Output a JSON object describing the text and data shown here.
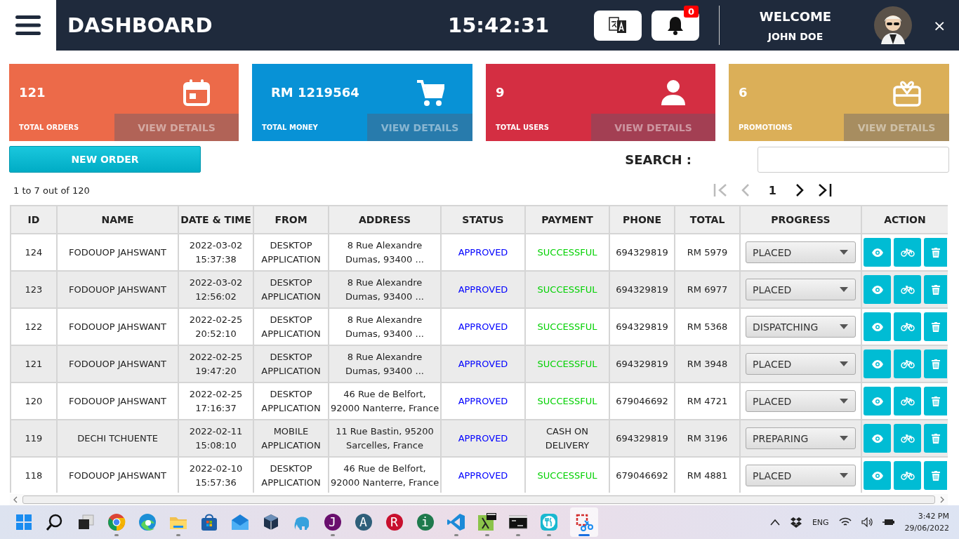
{
  "header": {
    "title": "DASHBOARD",
    "clock": "15:42:31",
    "notification_count": "0",
    "welcome": "WELCOME",
    "user": "JOHN DOE",
    "close": "×"
  },
  "cards": [
    {
      "kind": "calendar",
      "value": "121",
      "label": "TOTAL ORDERS",
      "link": "VIEW DETAILS",
      "color": "#ec6a49"
    },
    {
      "kind": "cart",
      "value": "RM 1219564",
      "label": "TOTAL MONEY",
      "link": "VIEW DETAILS",
      "color": "#0892d6"
    },
    {
      "kind": "user",
      "value": "9",
      "label": "TOTAL USERS",
      "link": "VIEW DETAILS",
      "color": "#d42e42"
    },
    {
      "kind": "gift",
      "value": "6",
      "label": "PROMOTIONS",
      "link": "VIEW DETAILS",
      "color": "#dbaf58"
    }
  ],
  "new_order_button": "NEW ORDER",
  "search": {
    "label": "SEARCH :"
  },
  "range": "1 to 7 out of 120",
  "pager": {
    "first_disabled": true,
    "prev_disabled": true,
    "page": "1",
    "next_disabled": false,
    "last_disabled": false
  },
  "table": {
    "columns": [
      "ID",
      "NAME",
      "DATE & TIME",
      "FROM",
      "ADDRESS",
      "STATUS",
      "PAYMENT",
      "PHONE",
      "TOTAL",
      "PROGRESS",
      "ACTION"
    ],
    "rows": [
      {
        "id": "124",
        "name": "FODOUOP JAHSWANT",
        "date": "2022-03-02",
        "time": "15:37:38",
        "from": [
          "DESKTOP",
          "APPLICATION"
        ],
        "address": [
          "8 Rue Alexandre",
          "Dumas, 93400 ..."
        ],
        "status": {
          "text": "APPROVED",
          "color": "#0000ff"
        },
        "payment": {
          "lines": [
            "SUCCESSFUL"
          ],
          "color": "#00d100"
        },
        "phone": "694329819",
        "total": "RM 5979",
        "progress": "PLACED"
      },
      {
        "id": "123",
        "name": "FODOUOP JAHSWANT",
        "date": "2022-03-02",
        "time": "12:56:02",
        "from": [
          "DESKTOP",
          "APPLICATION"
        ],
        "address": [
          "8 Rue Alexandre",
          "Dumas, 93400 ..."
        ],
        "status": {
          "text": "APPROVED",
          "color": "#0000ff"
        },
        "payment": {
          "lines": [
            "SUCCESSFUL"
          ],
          "color": "#00d100"
        },
        "phone": "694329819",
        "total": "RM 6977",
        "progress": "PLACED"
      },
      {
        "id": "122",
        "name": "FODOUOP JAHSWANT",
        "date": "2022-02-25",
        "time": "20:52:10",
        "from": [
          "DESKTOP",
          "APPLICATION"
        ],
        "address": [
          "8 Rue Alexandre",
          "Dumas, 93400 ..."
        ],
        "status": {
          "text": "APPROVED",
          "color": "#0000ff"
        },
        "payment": {
          "lines": [
            "SUCCESSFUL"
          ],
          "color": "#00d100"
        },
        "phone": "694329819",
        "total": "RM 5368",
        "progress": "DISPATCHING"
      },
      {
        "id": "121",
        "name": "FODOUOP JAHSWANT",
        "date": "2022-02-25",
        "time": "19:47:20",
        "from": [
          "DESKTOP",
          "APPLICATION"
        ],
        "address": [
          "8 Rue Alexandre",
          "Dumas, 93400 ..."
        ],
        "status": {
          "text": "APPROVED",
          "color": "#0000ff"
        },
        "payment": {
          "lines": [
            "SUCCESSFUL"
          ],
          "color": "#00d100"
        },
        "phone": "694329819",
        "total": "RM 3948",
        "progress": "PLACED"
      },
      {
        "id": "120",
        "name": "FODOUOP JAHSWANT",
        "date": "2022-02-25",
        "time": "17:16:37",
        "from": [
          "DESKTOP",
          "APPLICATION"
        ],
        "address": [
          "46 Rue de Belfort,",
          "92000 Nanterre, France"
        ],
        "status": {
          "text": "APPROVED",
          "color": "#0000ff"
        },
        "payment": {
          "lines": [
            "SUCCESSFUL"
          ],
          "color": "#00d100"
        },
        "phone": "679046692",
        "total": "RM 4721",
        "progress": "PLACED"
      },
      {
        "id": "119",
        "name": "DECHI TCHUENTE",
        "date": "2022-02-11",
        "time": "15:08:10",
        "from": [
          "MOBILE",
          "APPLICATION"
        ],
        "address": [
          "11 Rue Bastin, 95200",
          "Sarcelles, France"
        ],
        "status": {
          "text": "APPROVED",
          "color": "#0000ff"
        },
        "payment": {
          "lines": [
            "CASH ON",
            "DELIVERY"
          ],
          "color": "#222222"
        },
        "phone": "694329819",
        "total": "RM 3196",
        "progress": "PREPARING"
      },
      {
        "id": "118",
        "name": "FODOUOP JAHSWANT",
        "date": "2022-02-10",
        "time": "15:57:36",
        "from": [
          "DESKTOP",
          "APPLICATION"
        ],
        "address": [
          "46 Rue de Belfort,",
          "92000 Nanterre, France"
        ],
        "status": {
          "text": "APPROVED",
          "color": "#0000ff"
        },
        "payment": {
          "lines": [
            "SUCCESSFUL"
          ],
          "color": "#00d100"
        },
        "phone": "679046692",
        "total": "RM 4881",
        "progress": "PLACED"
      }
    ]
  },
  "taskbar": {
    "apps": [
      {
        "kind": "start",
        "running": false,
        "selected": false
      },
      {
        "kind": "search",
        "running": false,
        "selected": false
      },
      {
        "kind": "taskview",
        "running": false,
        "selected": false
      },
      {
        "kind": "chrome",
        "running": true,
        "selected": false
      },
      {
        "kind": "edge",
        "running": false,
        "selected": false
      },
      {
        "kind": "folder",
        "running": true,
        "selected": false
      },
      {
        "kind": "store",
        "running": false,
        "selected": false
      },
      {
        "kind": "mail",
        "running": false,
        "selected": false
      },
      {
        "kind": "cube",
        "running": false,
        "selected": false
      },
      {
        "kind": "elephant",
        "running": false,
        "selected": false
      },
      {
        "kind": "letter",
        "glyph": "J",
        "color": "#6a0f6e",
        "running": true,
        "selected": false
      },
      {
        "kind": "letter",
        "glyph": "A",
        "color": "#2f5f7a",
        "running": false,
        "selected": false
      },
      {
        "kind": "letter",
        "glyph": "R",
        "color": "#c8102e",
        "running": false,
        "selected": false
      },
      {
        "kind": "letter",
        "glyph": "i",
        "color": "#1f7a4d",
        "running": false,
        "selected": false
      },
      {
        "kind": "vscode",
        "running": true,
        "selected": false
      },
      {
        "kind": "lambda",
        "running": true,
        "selected": false
      },
      {
        "kind": "terminal",
        "running": true,
        "selected": false
      },
      {
        "kind": "food",
        "running": true,
        "selected": false
      },
      {
        "kind": "snip",
        "running": true,
        "selected": true
      }
    ],
    "language": "ENG",
    "time": "3:42 PM",
    "date": "29/06/2022"
  }
}
